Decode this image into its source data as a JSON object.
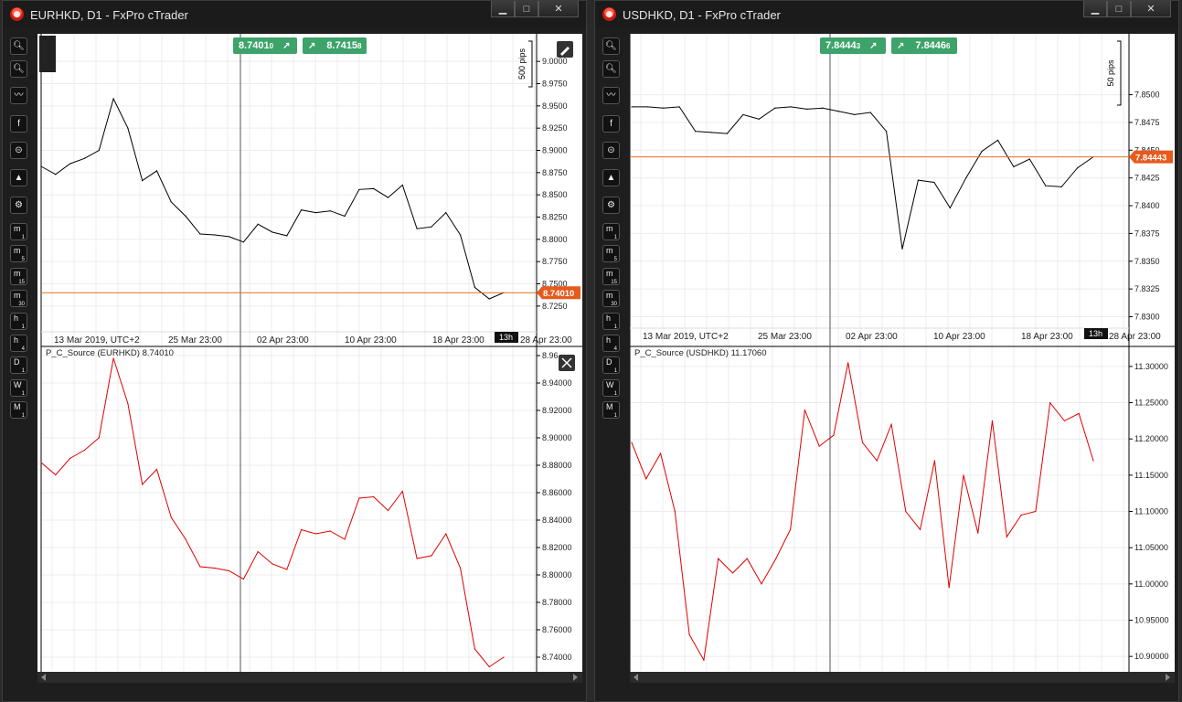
{
  "windows": [
    {
      "title": "EURHKD, D1 - FxPro cTrader",
      "bid_quote": "8.7401",
      "bid_quote_small": "0",
      "ask_quote": "8.7415",
      "ask_quote_small": "8",
      "pips_scale_label": "500 pips",
      "current_price_label": "8.74010",
      "timer_label": "13h",
      "date_axis": [
        "13 Mar 2019, UTC+2",
        "25 Mar 23:00",
        "02 Apr 23:00",
        "10 Apr 23:00",
        "18 Apr 23:00",
        "28 Apr 23:00"
      ],
      "price_axis": [
        "9.0000",
        "8.9750",
        "8.9500",
        "8.9250",
        "8.9000",
        "8.8750",
        "8.8500",
        "8.8250",
        "8.8000",
        "8.7750",
        "8.7500",
        "8.7250"
      ],
      "indicator_label": "P_C_Source (EURHKD) 8.74010",
      "indicator_axis": [
        "8.96",
        "8.94000",
        "8.92000",
        "8.90000",
        "8.88000",
        "8.86000",
        "8.84000",
        "8.82000",
        "8.80000",
        "8.78000",
        "8.76000",
        "8.74000"
      ]
    },
    {
      "title": "USDHKD, D1 - FxPro cTrader",
      "bid_quote": "7.8444",
      "bid_quote_small": "3",
      "ask_quote": "7.8446",
      "ask_quote_small": "6",
      "pips_scale_label": "50 pips",
      "current_price_label": "7.84443",
      "timer_label": "13h",
      "date_axis": [
        "13 Mar 2019, UTC+2",
        "25 Mar 23:00",
        "02 Apr 23:00",
        "10 Apr 23:00",
        "18 Apr 23:00",
        "28 Apr 23:00"
      ],
      "price_axis": [
        "7.8500",
        "7.8475",
        "7.8450",
        "7.8425",
        "7.8400",
        "7.8375",
        "7.8350",
        "7.8325",
        "7.8300"
      ],
      "indicator_label": "P_C_Source (USDHKD) 11.17060",
      "indicator_axis": [
        "11.30000",
        "11.25000",
        "11.20000",
        "11.15000",
        "11.10000",
        "11.05000",
        "11.00000",
        "10.95000",
        "10.90000"
      ]
    }
  ],
  "window_buttons": {
    "minimize": "▁",
    "maximize": "□",
    "close": "✕"
  },
  "toolbar": {
    "timeframes": [
      {
        "letter": "m",
        "num": "1"
      },
      {
        "letter": "m",
        "num": "5"
      },
      {
        "letter": "m",
        "num": "15"
      },
      {
        "letter": "m",
        "num": "30"
      },
      {
        "letter": "h",
        "num": "1"
      },
      {
        "letter": "h",
        "num": "4"
      },
      {
        "letter": "D",
        "num": "1"
      },
      {
        "letter": "W",
        "num": "1"
      },
      {
        "letter": "M",
        "num": "1"
      }
    ]
  },
  "colors": {
    "price_line": "#000000",
    "indicator_line": "#e00000",
    "bid_line": "#e07020",
    "quote_green": "#3da36a"
  },
  "chart_data": [
    {
      "type": "line",
      "title": "",
      "series": [
        {
          "values": [
            8.882,
            8.873,
            8.885,
            8.891,
            8.9,
            8.958,
            8.925,
            8.866,
            8.877,
            8.842,
            8.826,
            8.806,
            8.805,
            8.803,
            8.797,
            8.817,
            8.808,
            8.804,
            8.833,
            8.83,
            8.832,
            8.826,
            8.856,
            8.857,
            8.847,
            8.861,
            8.812,
            8.814,
            8.83,
            8.805,
            8.746,
            8.733,
            8.74
          ]
        }
      ],
      "ylim": [
        8.7125,
        9.0125
      ]
    },
    {
      "type": "line",
      "title": "",
      "series": [
        {
          "name": "P_C_Source (EURHKD)",
          "values": [
            8.882,
            8.873,
            8.885,
            8.891,
            8.9,
            8.958,
            8.925,
            8.866,
            8.877,
            8.842,
            8.826,
            8.806,
            8.805,
            8.803,
            8.797,
            8.817,
            8.808,
            8.804,
            8.833,
            8.83,
            8.832,
            8.826,
            8.856,
            8.857,
            8.847,
            8.861,
            8.812,
            8.814,
            8.83,
            8.805,
            8.746,
            8.733,
            8.74
          ]
        }
      ],
      "ylim": [
        8.73,
        8.96
      ]
    },
    {
      "type": "line",
      "title": "",
      "series": [
        {
          "values": [
            7.8489,
            7.8489,
            7.8488,
            7.8489,
            7.8467,
            7.8466,
            7.8465,
            7.8482,
            7.8478,
            7.8488,
            7.8489,
            7.8487,
            7.8488,
            7.8485,
            7.8482,
            7.8484,
            7.8467,
            7.8361,
            7.8423,
            7.8421,
            7.8398,
            7.8425,
            7.8449,
            7.8459,
            7.8435,
            7.8442,
            7.8418,
            7.8417,
            7.8434,
            7.8444
          ]
        }
      ],
      "ylim": [
        7.8293,
        7.854
      ]
    },
    {
      "type": "line",
      "title": "",
      "series": [
        {
          "name": "P_C_Source (USDHKD)",
          "values": [
            11.195,
            11.145,
            11.18,
            11.1,
            10.93,
            10.895,
            11.035,
            11.015,
            11.035,
            11.0,
            11.035,
            11.075,
            11.24,
            11.19,
            11.205,
            11.305,
            11.195,
            11.17,
            11.22,
            11.1,
            11.075,
            11.17,
            10.995,
            11.15,
            11.07,
            11.225,
            11.065,
            11.095,
            11.1,
            11.25,
            11.225,
            11.235,
            11.17
          ]
        }
      ],
      "ylim": [
        10.88,
        11.315
      ]
    }
  ]
}
